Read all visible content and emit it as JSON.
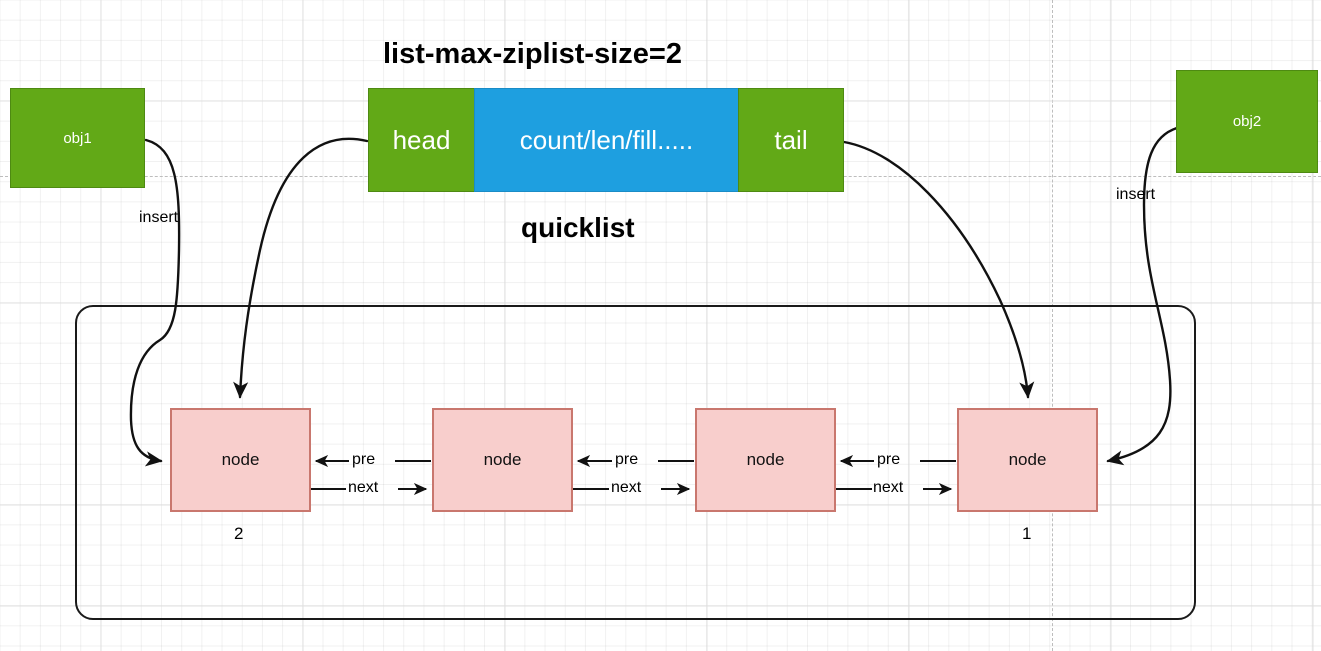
{
  "diagram": {
    "type": "pointer-structure-diagram",
    "title": "list-max-ziplist-size=2",
    "subtitle": "quicklist",
    "colors": {
      "green": "#62A917",
      "blue": "#1E9FE0",
      "node_fill": "#F8CECC",
      "node_border": "#C9776E",
      "stroke": "#1a1a1a",
      "grid": "#e8e8e8"
    },
    "objects": [
      {
        "id": "obj1",
        "label": "obj1",
        "side": "left"
      },
      {
        "id": "obj2",
        "label": "obj2",
        "side": "right"
      }
    ],
    "quicklist": {
      "label": "quicklist",
      "fields": [
        {
          "id": "head",
          "label": "head",
          "color": "green"
        },
        {
          "id": "body",
          "label": "count/len/fill.....",
          "color": "blue"
        },
        {
          "id": "tail",
          "label": "tail",
          "color": "green"
        }
      ]
    },
    "nodes": [
      {
        "id": "node-1",
        "label": "node",
        "index": "2"
      },
      {
        "id": "node-2",
        "label": "node",
        "index": ""
      },
      {
        "id": "node-3",
        "label": "node",
        "index": ""
      },
      {
        "id": "node-4",
        "label": "node",
        "index": "1"
      }
    ],
    "link_labels": {
      "pre": "pre",
      "next": "next"
    },
    "pointer_pairs": [
      {
        "from": "node-2",
        "to": "node-1",
        "pre": "pre",
        "next": "next"
      },
      {
        "from": "node-3",
        "to": "node-2",
        "pre": "pre",
        "next": "next"
      },
      {
        "from": "node-4",
        "to": "node-3",
        "pre": "pre",
        "next": "next"
      }
    ],
    "edges": [
      {
        "id": "obj1-insert",
        "label": "insert",
        "from": "obj1",
        "to": "node-1"
      },
      {
        "id": "obj2-insert",
        "label": "insert",
        "from": "obj2",
        "to": "node-4"
      },
      {
        "id": "head-edge",
        "label": "",
        "from": "head",
        "to": "node-1"
      },
      {
        "id": "tail-edge",
        "label": "",
        "from": "tail",
        "to": "node-4"
      }
    ]
  }
}
